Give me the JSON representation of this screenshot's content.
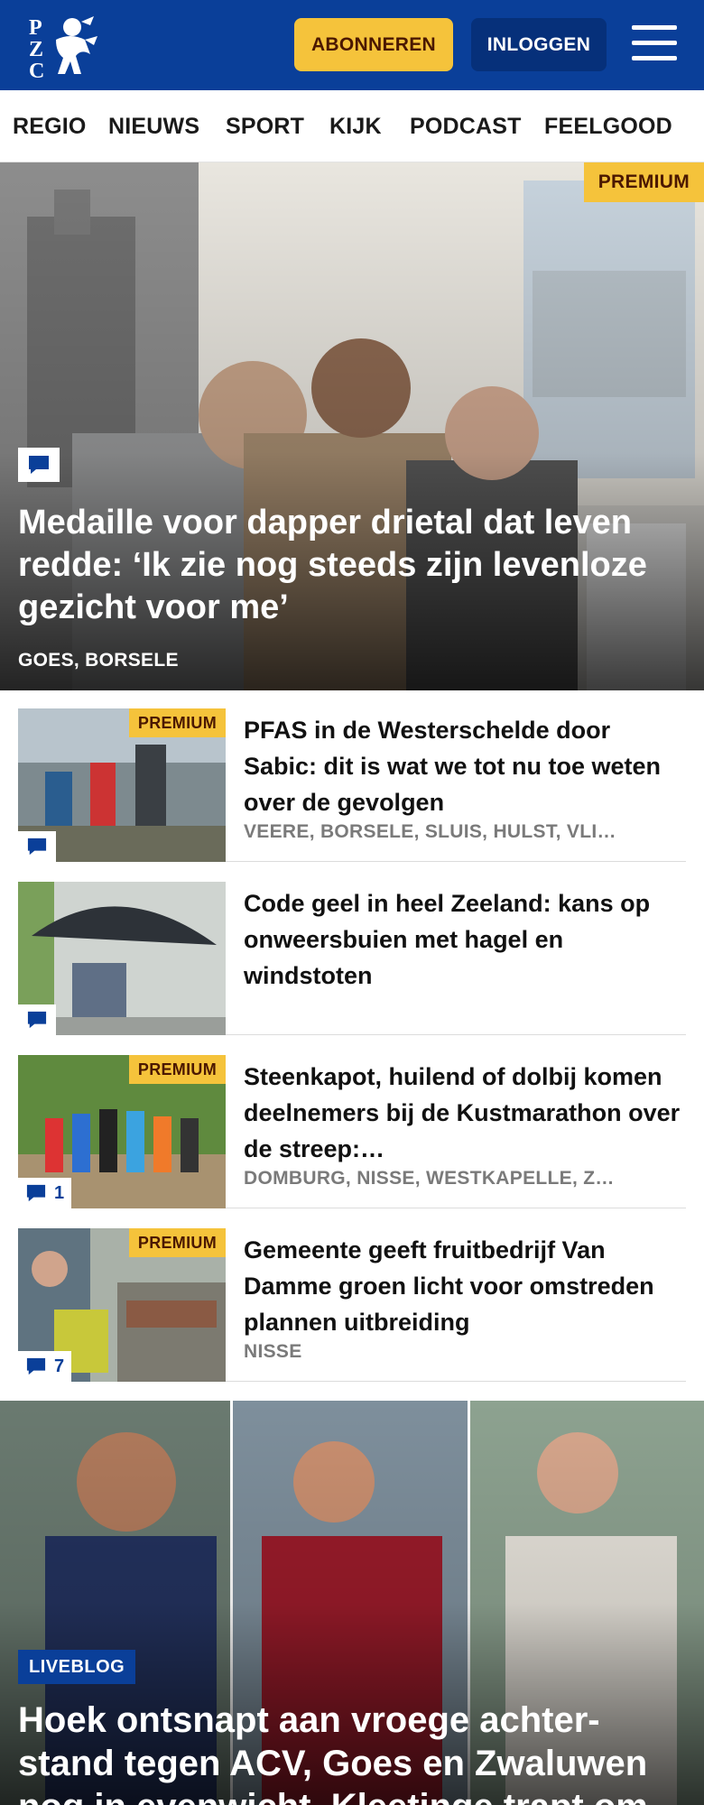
{
  "header": {
    "logo_text": "PZC",
    "subscribe_label": "ABONNEREN",
    "login_label": "INLOGGEN"
  },
  "nav": {
    "items": [
      "REGIO",
      "NIEUWS",
      "SPORT",
      "KIJK",
      "PODCAST",
      "FEELGOOD"
    ]
  },
  "hero": {
    "badge": "PREMIUM",
    "title": "Medaille voor dapper drietal dat leven redde: ‘Ik zie nog steeds zijn levenloze gezicht voor me’",
    "location": "GOES, BORSELE"
  },
  "articles": [
    {
      "badge": "PREMIUM",
      "title": "PFAS in de Westerschelde door Sabic: dit is wat we tot nu toe weten over de gevolgen",
      "location": "VEERE, BORSELE, SLUIS, HULST, VLI…",
      "comments": ""
    },
    {
      "badge": "",
      "title": "Code geel in heel Zeeland: kans op onweersbuien met hagel en windstoten",
      "location": "",
      "comments": ""
    },
    {
      "badge": "PREMIUM",
      "title": "Steenkapot, huilend of dolbij komen deelnemers bij de Kustmarathon over de streep:…",
      "location": "DOMBURG, NISSE, WESTKAPELLE, Z…",
      "comments": "1"
    },
    {
      "badge": "PREMIUM",
      "title": "Gemeente geeft fruitbedrijf Van Damme groen licht voor omstreden plannen uitbreiding",
      "location": "NISSE",
      "comments": "7"
    }
  ],
  "liveblog": {
    "badge": "LIVEBLOG",
    "title": "Hoek ontsnapt aan vroege achter-stand tegen ACV, Goes en Zwaluwen nog in evenwicht, Kleetinge trapt om"
  },
  "colors": {
    "brand_blue": "#0a3f99",
    "premium_yellow": "#f5c33b",
    "location_gray": "#7a7a7a"
  },
  "icons": [
    "logo-lion-icon",
    "hamburger-menu-icon",
    "comment-bubble-icon"
  ]
}
